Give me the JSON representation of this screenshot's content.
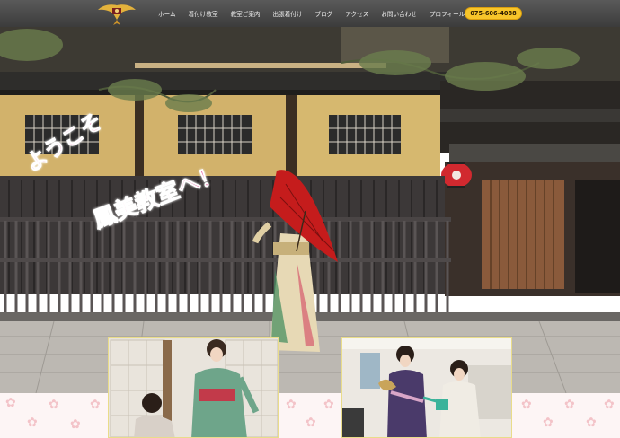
{
  "header": {
    "logo_icon": "phoenix-crest-icon",
    "nav": [
      {
        "label": "ホーム"
      },
      {
        "label": "着付け教室"
      },
      {
        "label": "教室ご案内"
      },
      {
        "label": "出張着付け"
      },
      {
        "label": "ブログ"
      },
      {
        "label": "アクセス"
      },
      {
        "label": "お問い合わせ"
      },
      {
        "label": "プロフィール"
      }
    ],
    "phone": "075-606-4088"
  },
  "hero": {
    "tagline_line1": "ようこそ",
    "tagline_line2": "鳳美教室へ！"
  },
  "colors": {
    "header_bg": "#4a4a4a",
    "phone_bg": "#f7c52a",
    "tagline": "#ea5fa2",
    "strip_bg": "#fdf5f5"
  }
}
